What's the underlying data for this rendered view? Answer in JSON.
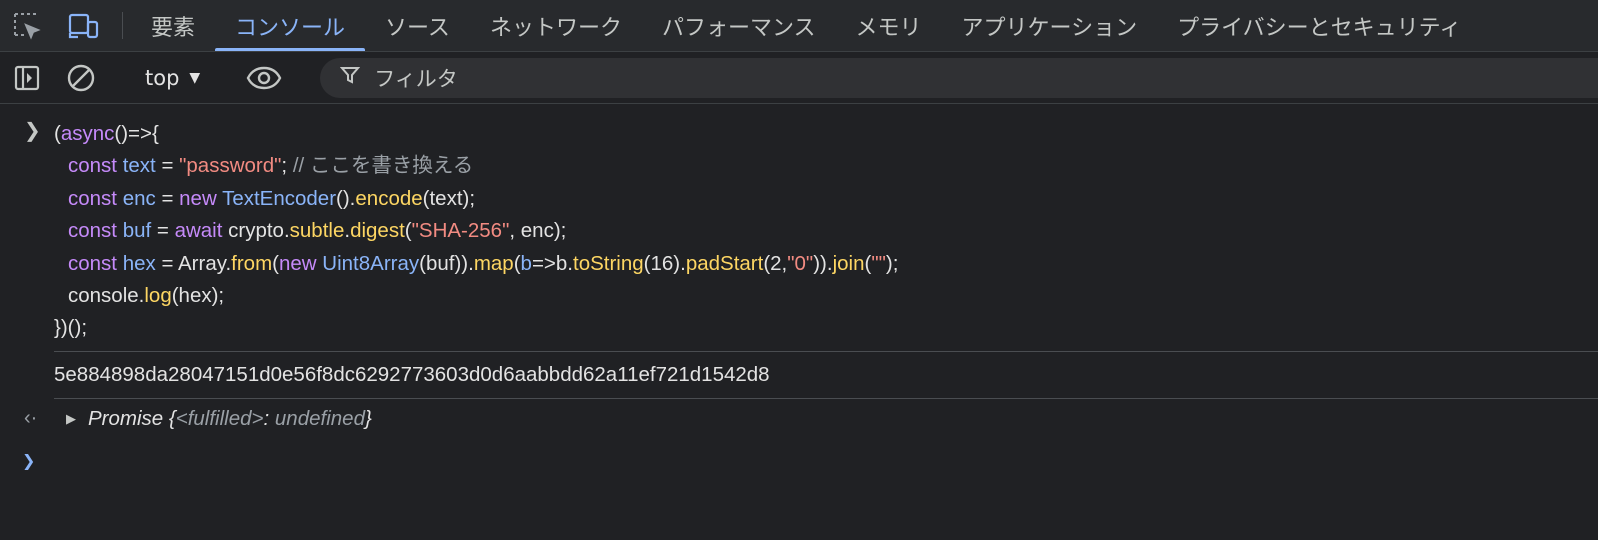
{
  "tabs": [
    {
      "label": "要素",
      "active": false
    },
    {
      "label": "コンソール",
      "active": true
    },
    {
      "label": "ソース",
      "active": false
    },
    {
      "label": "ネットワーク",
      "active": false
    },
    {
      "label": "パフォーマンス",
      "active": false
    },
    {
      "label": "メモリ",
      "active": false
    },
    {
      "label": "アプリケーション",
      "active": false
    },
    {
      "label": "プライバシーとセキュリティ",
      "active": false
    }
  ],
  "toolbar": {
    "context": "top",
    "filter_placeholder": "フィルタ"
  },
  "colors": {
    "accent": "#8ab4f8",
    "keyword": "#c58af9",
    "string": "#f28b82",
    "function": "#fdd663",
    "background": "#202124"
  },
  "code": {
    "l1a": "(",
    "l1b": "async",
    "l1c": "()=>{",
    "l2_kw": "const",
    "l2_var": "text",
    "l2_eq": " = ",
    "l2_str": "\"password\"",
    "l2_semi": "; ",
    "l2_cmt": "// ここを書き換える",
    "l3_kw": "const",
    "l3_var": "enc",
    "l3_eq": " = ",
    "l3_new": "new",
    "l3_cls": "TextEncoder",
    "l3_a": "().",
    "l3_fn": "encode",
    "l3_b": "(text);",
    "l4_kw": "const",
    "l4_var": "buf",
    "l4_eq": " = ",
    "l4_await": "await",
    "l4_a": " crypto.",
    "l4_fn1": "subtle",
    "l4_dot": ".",
    "l4_fn2": "digest",
    "l4_b": "(",
    "l4_str": "\"SHA-256\"",
    "l4_c": ", enc);",
    "l5_kw": "const",
    "l5_var": "hex",
    "l5_a": " = Array.",
    "l5_fn1": "from",
    "l5_b": "(",
    "l5_new": "new",
    "l5_cls": "Uint8Array",
    "l5_c": "(buf)).",
    "l5_fn2": "map",
    "l5_d": "(",
    "l5_param": "b",
    "l5_e": "=>b.",
    "l5_fn3": "toString",
    "l5_f": "(16).",
    "l5_fn4": "padStart",
    "l5_g": "(2,",
    "l5_str1": "\"0\"",
    "l5_h": ")).",
    "l5_fn5": "join",
    "l5_i": "(",
    "l5_str2": "\"\"",
    "l5_j": ");",
    "l6_a": "console.",
    "l6_fn": "log",
    "l6_b": "(hex);",
    "l7": "})();"
  },
  "output": {
    "hash": "5e884898da28047151d0e56f8dc6292773603d0d6aabbdd62a11ef721d1542d8"
  },
  "result": {
    "name": "Promise",
    "open": " {",
    "state_key": "<fulfilled>",
    "colon": ": ",
    "state_val": "undefined",
    "close": "}"
  }
}
